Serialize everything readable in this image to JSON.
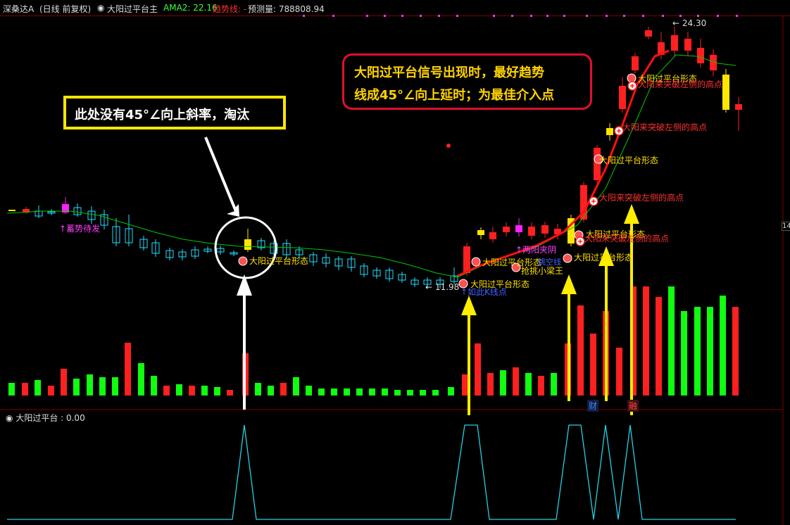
{
  "header": {
    "stock": "深桑达A",
    "period": "(日线 前复权)",
    "indicator_name": "大阳过平台主",
    "ama_label": "AMA2: 22.16",
    "trend_label": "趋势线: -",
    "forecast_label": "预测量: 788808.94"
  },
  "callouts": {
    "red_line1": "大阳过平台信号出现时，最好趋势",
    "red_line2": "线成45°∠向上延时；为最佳介入点",
    "yellow": "此处没有45°∠向上斜率，淘汰"
  },
  "chart_labels": {
    "high_price": "24.30",
    "low_price": "11.98",
    "right_edge": "14",
    "xuming": "蓄势待发",
    "pattern": "大阳过平台形态",
    "breakout": "大阳来突破左侧的高点",
    "liang_yang": "两阳夹阴",
    "qiangtiao": "抢挑小梁王",
    "tiaokong": "跳空线",
    "zhiding": "如此K线点",
    "cai": "财",
    "rong": "融"
  },
  "indicator": {
    "title": "大阳过平台 : 0.00"
  },
  "colors": {
    "up": "#ff2020",
    "down": "#20e0ff",
    "vol_green": "#10ff10",
    "ma": "#00d000",
    "red_trend": "#ff1010",
    "signal_line": "#28d0e0",
    "arrow_yellow": "#ffee00"
  }
}
